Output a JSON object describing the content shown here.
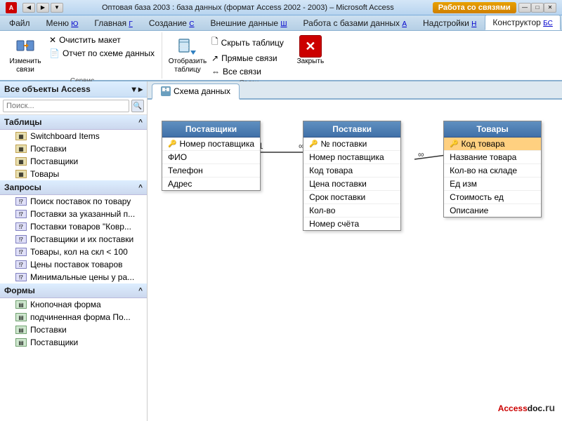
{
  "titleBar": {
    "icon": "A",
    "title": "Оптовая база 2003 : база данных (формат Access 2002 - 2003)  –  Microsoft Access",
    "workBtn": "Работа со связями"
  },
  "ribbonTabs": [
    {
      "label": "Файл",
      "hotkey": "Ф",
      "active": false
    },
    {
      "label": "Меню",
      "hotkey": "Ю",
      "active": false
    },
    {
      "label": "Главная",
      "hotkey": "Г",
      "active": false
    },
    {
      "label": "Создание",
      "hotkey": "С",
      "active": false
    },
    {
      "label": "Внешние данные",
      "hotkey": "Ш",
      "active": false
    },
    {
      "label": "Работа с базами данных",
      "hotkey": "А",
      "active": false
    },
    {
      "label": "Надстройки",
      "hotkey": "Н",
      "active": false
    },
    {
      "label": "Конструктор",
      "hotkey": "БС",
      "active": true
    }
  ],
  "ribbonGroups": {
    "group1": {
      "label": "Сервис",
      "changeLinksBtn": "Изменить\nсвязи",
      "clearLayoutBtn": "Очистить макет",
      "schemaReportBtn": "Отчет по схеме данных"
    },
    "group2": {
      "label": "Связи",
      "showTableBtn": "Отобразить\nтаблицу",
      "hideTableBtn": "Скрыть таблицу",
      "directLinksBtn": "Прямые связи",
      "allLinksBtn": "Все связи",
      "closeBtn": "Закрыть"
    }
  },
  "leftPanel": {
    "title": "Все объекты Access",
    "searchPlaceholder": "Поиск...",
    "sections": {
      "tables": {
        "label": "Таблицы",
        "items": [
          {
            "name": "Switchboard Items",
            "type": "table"
          },
          {
            "name": "Поставки",
            "type": "table"
          },
          {
            "name": "Поставщики",
            "type": "table"
          },
          {
            "name": "Товары",
            "type": "table"
          }
        ]
      },
      "queries": {
        "label": "Запросы",
        "items": [
          {
            "name": "Поиск поставок по товару",
            "type": "query"
          },
          {
            "name": "Поставки за указанный п...",
            "type": "query"
          },
          {
            "name": "Поставки товаров \"Ковр...",
            "type": "query"
          },
          {
            "name": "Поставщики и их поставки",
            "type": "query"
          },
          {
            "name": "Товары, кол на скл < 100",
            "type": "query"
          },
          {
            "name": "Цены поставок товаров",
            "type": "query"
          },
          {
            "name": "Минимальные цены у ра...",
            "type": "query"
          }
        ]
      },
      "forms": {
        "label": "Формы",
        "items": [
          {
            "name": "Кнопочная форма",
            "type": "form"
          },
          {
            "name": "подчиненная форма По...",
            "type": "form"
          },
          {
            "name": "Поставки",
            "type": "form"
          },
          {
            "name": "Поставщики",
            "type": "form"
          }
        ]
      }
    }
  },
  "diagram": {
    "tabLabel": "Схема данных",
    "tables": {
      "suppliers": {
        "title": "Поставщики",
        "fields": [
          {
            "name": "Номер поставщика",
            "key": true
          },
          {
            "name": "ФИО",
            "key": false
          },
          {
            "name": "Телефон",
            "key": false
          },
          {
            "name": "Адрес",
            "key": false
          }
        ]
      },
      "deliveries": {
        "title": "Поставки",
        "fields": [
          {
            "name": "№ поставки",
            "key": true
          },
          {
            "name": "Номер поставщика",
            "key": false
          },
          {
            "name": "Код товара",
            "key": false
          },
          {
            "name": "Цена поставки",
            "key": false
          },
          {
            "name": "Срок поставки",
            "key": false
          },
          {
            "name": "Кол-во",
            "key": false
          },
          {
            "name": "Номер счёта",
            "key": false
          }
        ]
      },
      "goods": {
        "title": "Товары",
        "fields": [
          {
            "name": "Код товара",
            "key": true,
            "selected": true
          },
          {
            "name": "Название товара",
            "key": false
          },
          {
            "name": "Кол-во на складе",
            "key": false
          },
          {
            "name": "Ед изм",
            "key": false
          },
          {
            "name": "Стоимость ед",
            "key": false
          },
          {
            "name": "Описание",
            "key": false
          }
        ]
      }
    }
  },
  "watermark": {
    "text": "Accessdoc.ru"
  }
}
